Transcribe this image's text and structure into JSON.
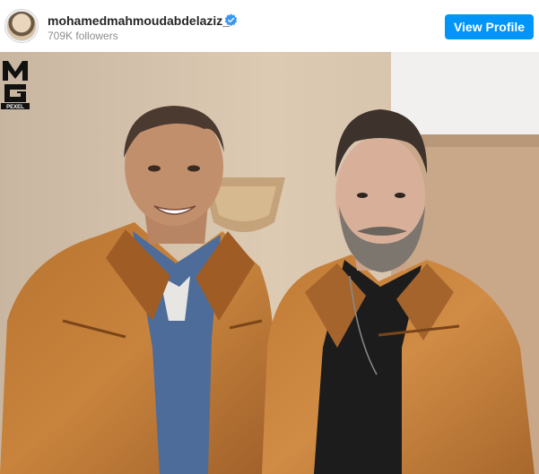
{
  "profile": {
    "username": "mohamedmahmoudabdelaziz_",
    "followers": "709K followers",
    "verified": true,
    "avatar_icon": "profile-photo"
  },
  "actions": {
    "view_profile_label": "View Profile"
  },
  "post": {
    "watermark_text": "MG PEXEL"
  },
  "colors": {
    "accent": "#0095f6",
    "username": "#262626",
    "muted": "#8e8e8e",
    "verified_badge": "#3897f0"
  }
}
